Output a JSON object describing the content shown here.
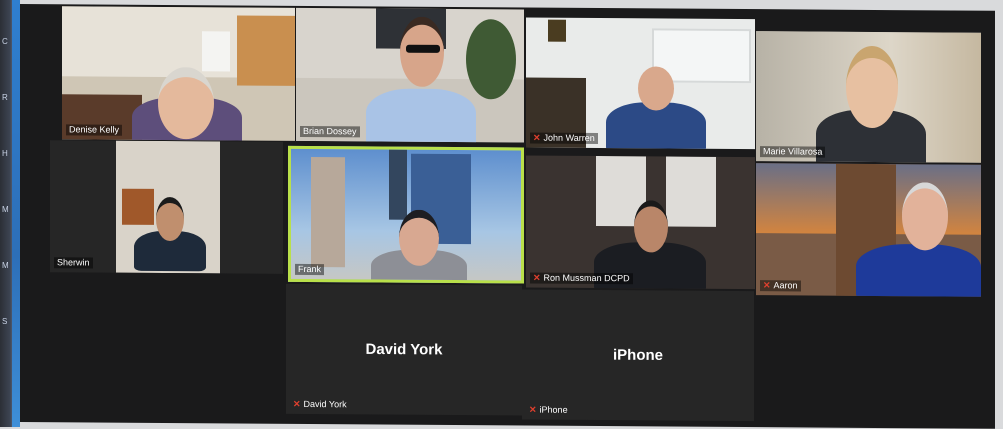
{
  "participants": [
    {
      "name": "Denise Kelly",
      "video": true,
      "muted": false
    },
    {
      "name": "Brian Dossey",
      "video": true,
      "muted": false
    },
    {
      "name": "John Warren",
      "video": true,
      "muted": true
    },
    {
      "name": "Marie Villarosa",
      "video": true,
      "muted": false
    },
    {
      "name": "Sherwin",
      "video": true,
      "muted": false
    },
    {
      "name": "Frank",
      "video": true,
      "muted": false,
      "active_speaker": true
    },
    {
      "name": "Ron Mussman DCPD",
      "video": true,
      "muted": true
    },
    {
      "name": "Aaron",
      "video": true,
      "muted": true
    },
    {
      "name": "David York",
      "video": false,
      "muted": true
    },
    {
      "name": "iPhone",
      "video": false,
      "muted": true
    }
  ],
  "side_letters": [
    "C",
    "R",
    "H",
    "M",
    "M",
    "S"
  ],
  "colors": {
    "active_speaker_border": "#b9e04a",
    "muted_icon": "#e0402e",
    "tile_background": "#262626"
  }
}
